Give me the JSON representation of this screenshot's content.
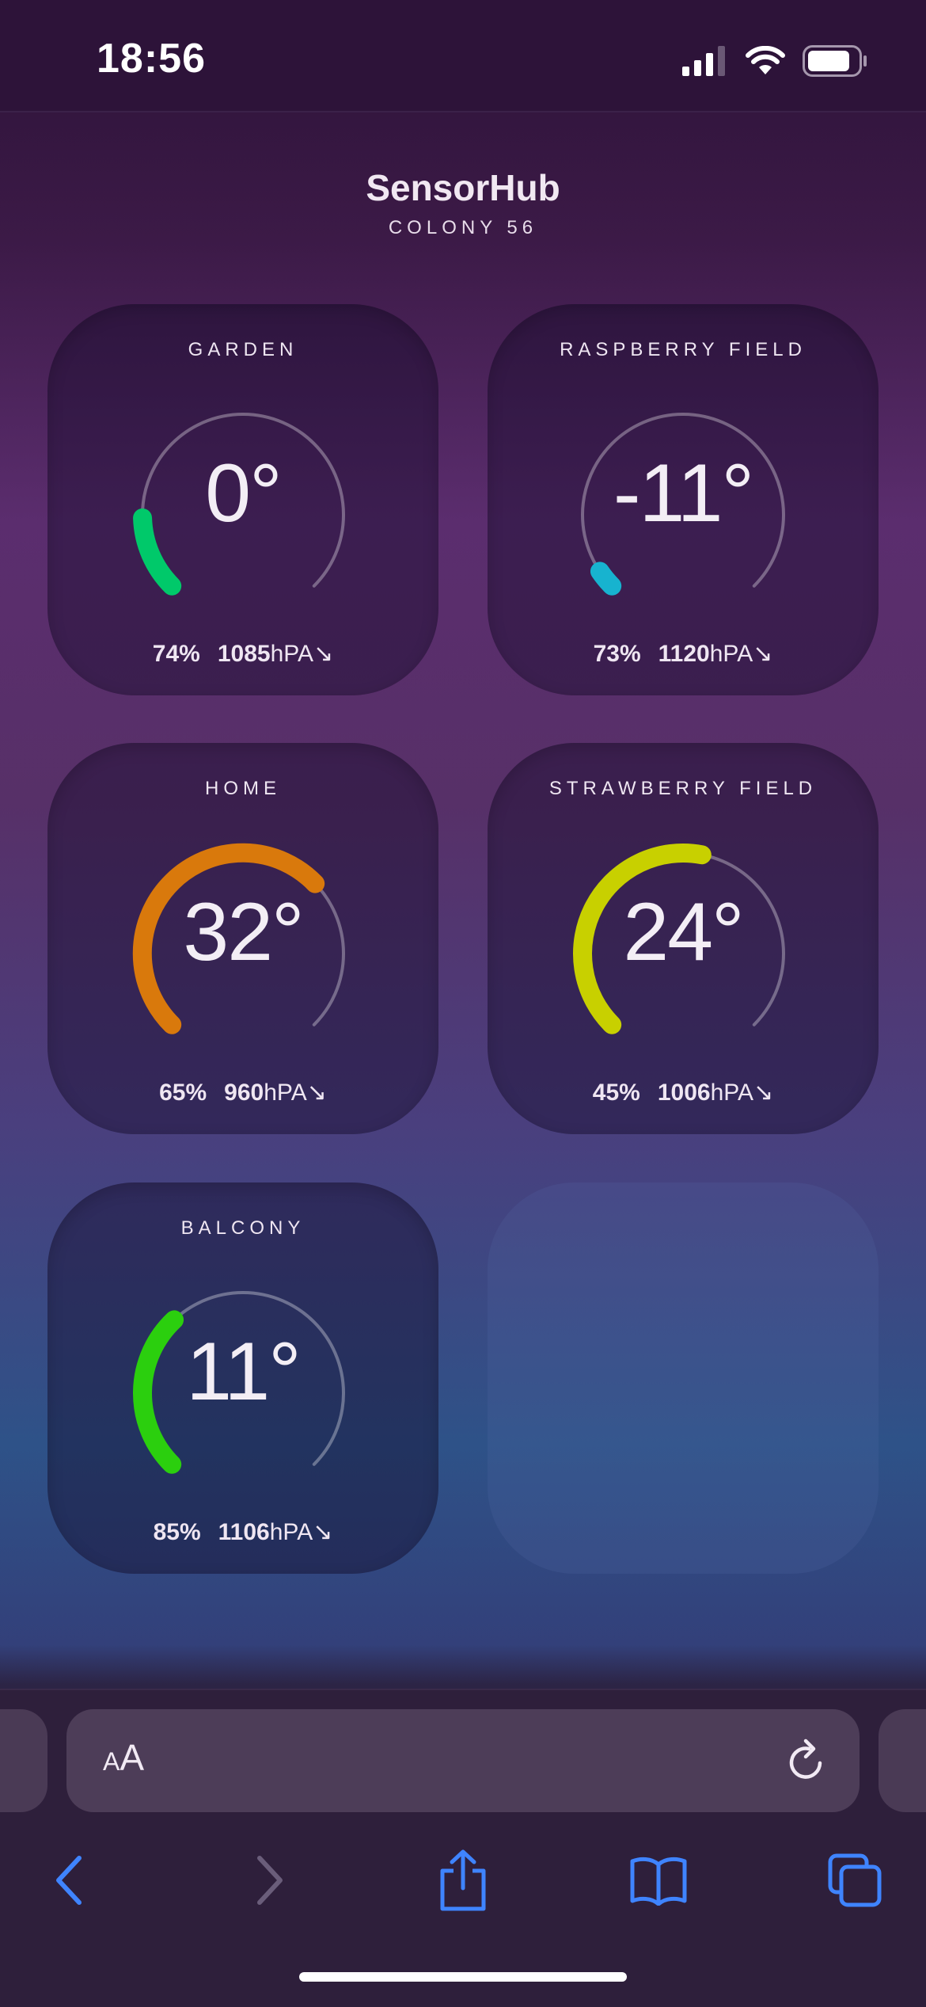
{
  "status": {
    "time": "18:56"
  },
  "header": {
    "title": "SensorHub",
    "subtitle": "COLONY 56"
  },
  "sensors": [
    {
      "name": "GARDEN",
      "temperature": "0°",
      "humidity": "74%",
      "pressure": "1085",
      "pressure_unit": "hPA",
      "trend": "↘",
      "gauge_color": "#00c96a",
      "gauge_fraction": 0.16
    },
    {
      "name": "RASPBERRY FIELD",
      "temperature": "-11°",
      "humidity": "73%",
      "pressure": "1120",
      "pressure_unit": "hPA",
      "trend": "↘",
      "gauge_color": "#17b3cf",
      "gauge_fraction": 0.04
    },
    {
      "name": "HOME",
      "temperature": "32°",
      "humidity": "65%",
      "pressure": "960",
      "pressure_unit": "hPA",
      "trend": "↘",
      "gauge_color": "#d9790c",
      "gauge_fraction": 0.67
    },
    {
      "name": "STRAWBERRY FIELD",
      "temperature": "24°",
      "humidity": "45%",
      "pressure": "1006",
      "pressure_unit": "hPA",
      "trend": "↘",
      "gauge_color": "#c8d000",
      "gauge_fraction": 0.54
    },
    {
      "name": "BALCONY",
      "temperature": "11°",
      "humidity": "85%",
      "pressure": "1106",
      "pressure_unit": "hPA",
      "trend": "↘",
      "gauge_color": "#2bcf0e",
      "gauge_fraction": 0.34
    }
  ],
  "browser": {
    "text_size_label_small": "A",
    "text_size_label_large": "A"
  },
  "icons": [
    "signal-icon",
    "wifi-icon",
    "battery-icon",
    "text-size-icon",
    "reload-icon",
    "back-icon",
    "forward-icon",
    "share-icon",
    "bookmarks-icon",
    "tabs-icon"
  ]
}
